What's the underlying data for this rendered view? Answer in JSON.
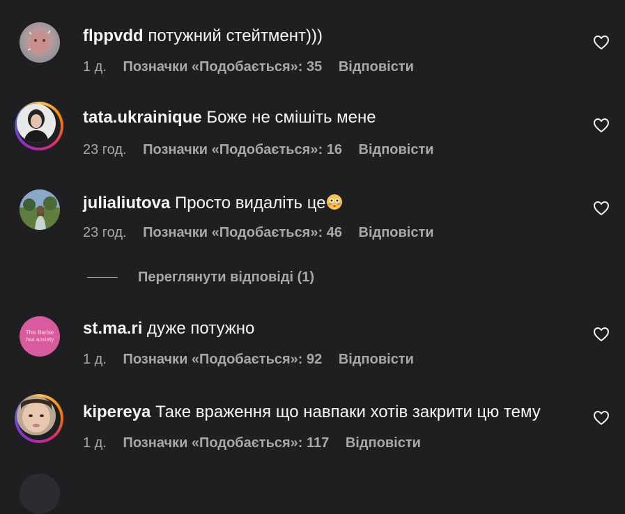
{
  "comments": [
    {
      "username": "flppvdd",
      "text": "потужний стейтмент)))",
      "time": "1 д.",
      "likes": "Позначки «Подобається»: 35",
      "reply": "Відповісти"
    },
    {
      "username": "tata.ukrainique",
      "text": "Боже не смішіть мене",
      "time": "23 год.",
      "likes": "Позначки «Подобається»: 16",
      "reply": "Відповісти"
    },
    {
      "username": "julialiutova",
      "text": "Просто видаліть це",
      "time": "23 год.",
      "likes": "Позначки «Подобається»: 46",
      "reply": "Відповісти"
    },
    {
      "username": "st.ma.ri",
      "text": "дуже потужно",
      "time": "1 д.",
      "likes": "Позначки «Подобається»: 92",
      "reply": "Відповісти",
      "avatar_text": "This Barbie has anxiety"
    },
    {
      "username": "kipereya",
      "text": "Таке враження що навпаки хотів закрити цю тему",
      "time": "1 д.",
      "likes": "Позначки «Подобається»: 117",
      "reply": "Відповісти"
    }
  ],
  "view_replies": "Переглянути відповіді (1)",
  "icons": {
    "like": "heart-outline-icon",
    "emoji": "flushed-face-emoji"
  },
  "colors": {
    "background": "#1f1f22",
    "primary_text": "#f5f5f5",
    "secondary_text": "#a8a8a8",
    "story_ring": "#d62976"
  }
}
